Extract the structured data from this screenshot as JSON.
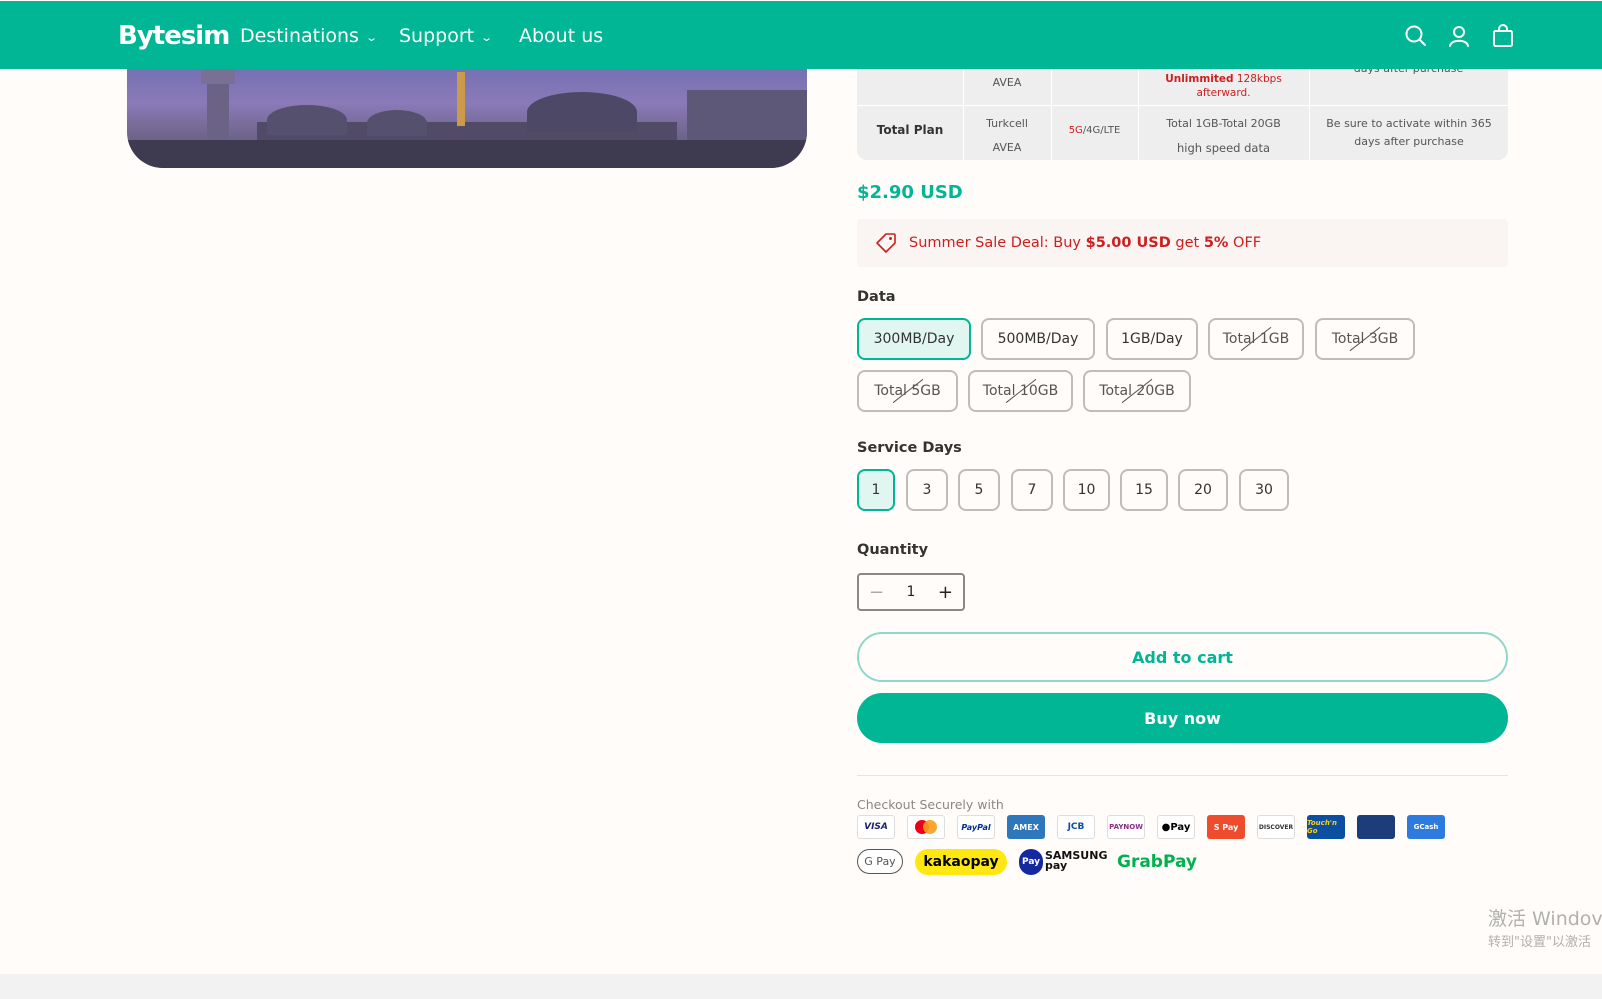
{
  "header": {
    "logo": "Bytesim",
    "nav": [
      {
        "label": "Destinations",
        "has_dropdown": true
      },
      {
        "label": "Support",
        "has_dropdown": true
      },
      {
        "label": "About us",
        "has_dropdown": false
      }
    ],
    "icons": [
      "search-icon",
      "account-icon",
      "cart-icon"
    ],
    "bg_color": "#00b694"
  },
  "spec_table": {
    "row1": {
      "operator": "AVEA",
      "speed_note_bold": "Unlimmited",
      "speed_note": "128kbps afterward.",
      "activation": "days after purchase"
    },
    "row2": {
      "plan": "Total Plan",
      "operator1": "Turkcell",
      "operator2": "AVEA",
      "network_5g": "5G",
      "network_rest": "/4G/LTE",
      "data1": "Total 1GB-Total 20GB",
      "data2": "high speed data",
      "activation": "Be sure to activate within 365 days after purchase"
    }
  },
  "price": "$2.90 USD",
  "deal": {
    "prefix": "Summer Sale Deal: Buy ",
    "amount": "$5.00 USD",
    "middle": " get ",
    "percent": "5%",
    "suffix": " OFF"
  },
  "data_section": {
    "label": "Data",
    "options": [
      {
        "label": "300MB/Day",
        "selected": true,
        "available": true
      },
      {
        "label": "500MB/Day",
        "selected": false,
        "available": true
      },
      {
        "label": "1GB/Day",
        "selected": false,
        "available": true
      },
      {
        "label": "Total 1GB",
        "selected": false,
        "available": false
      },
      {
        "label": "Total 3GB",
        "selected": false,
        "available": false
      },
      {
        "label": "Total 5GB",
        "selected": false,
        "available": false
      },
      {
        "label": "Total 10GB",
        "selected": false,
        "available": false
      },
      {
        "label": "Total 20GB",
        "selected": false,
        "available": false
      }
    ]
  },
  "days_section": {
    "label": "Service Days",
    "options": [
      {
        "label": "1",
        "selected": true
      },
      {
        "label": "3",
        "selected": false
      },
      {
        "label": "5",
        "selected": false
      },
      {
        "label": "7",
        "selected": false
      },
      {
        "label": "10",
        "selected": false
      },
      {
        "label": "15",
        "selected": false
      },
      {
        "label": "20",
        "selected": false
      },
      {
        "label": "30",
        "selected": false
      }
    ]
  },
  "quantity": {
    "label": "Quantity",
    "value": "1",
    "minus": "−",
    "plus": "+"
  },
  "buttons": {
    "add_to_cart": "Add to cart",
    "buy_now": "Buy now"
  },
  "checkout": {
    "label": "Checkout Securely with",
    "methods_row1": [
      "VISA",
      "",
      "PayPal",
      "AMEX",
      "JCB",
      "PAYNOW",
      " Pay",
      "S Pay",
      "DISCOVER",
      "Touch'n Go",
      "",
      "GCash"
    ],
    "methods_row2": [
      "G Pay",
      "kakaopay",
      "Pay",
      "SAMSUNG pay",
      "GrabPay"
    ]
  },
  "watermark": {
    "line1": "激活 Windov",
    "line2": "转到\"设置\"以激活"
  },
  "colors": {
    "accent": "#00b694",
    "deal_red": "#cc1f1f",
    "bg": "#fffcf9"
  }
}
